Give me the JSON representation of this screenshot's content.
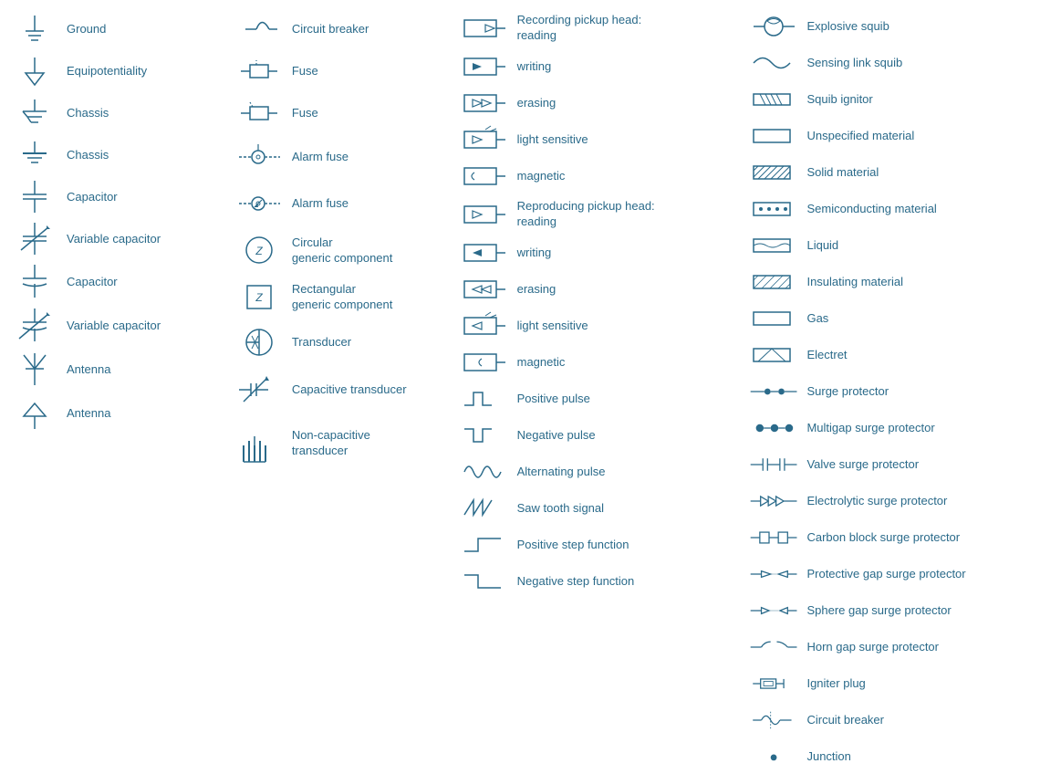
{
  "columns": [
    {
      "id": "col1",
      "items": [
        {
          "id": "ground",
          "label": "Ground"
        },
        {
          "id": "equipotentiality",
          "label": "Equipotentiality"
        },
        {
          "id": "chassis1",
          "label": "Chassis"
        },
        {
          "id": "chassis2",
          "label": "Chassis"
        },
        {
          "id": "capacitor1",
          "label": "Capacitor"
        },
        {
          "id": "variable-capacitor1",
          "label": "Variable capacitor"
        },
        {
          "id": "capacitor2",
          "label": "Capacitor"
        },
        {
          "id": "variable-capacitor2",
          "label": "Variable capacitor"
        },
        {
          "id": "antenna1",
          "label": "Antenna"
        },
        {
          "id": "antenna2",
          "label": "Antenna"
        }
      ]
    },
    {
      "id": "col2",
      "items": [
        {
          "id": "circuit-breaker",
          "label": "Circuit breaker"
        },
        {
          "id": "fuse1",
          "label": "Fuse"
        },
        {
          "id": "fuse2",
          "label": "Fuse"
        },
        {
          "id": "alarm-fuse1",
          "label": "Alarm fuse"
        },
        {
          "id": "alarm-fuse2",
          "label": "Alarm fuse"
        },
        {
          "id": "circular-generic",
          "label": "Circular\ngeneric component"
        },
        {
          "id": "rectangular-generic",
          "label": "Rectangular\ngeneric component"
        },
        {
          "id": "transducer",
          "label": "Transducer"
        },
        {
          "id": "capacitive-transducer",
          "label": "Capacitive transducer"
        },
        {
          "id": "non-capacitive-transducer",
          "label": "Non-capacitive\ntransducer"
        }
      ]
    },
    {
      "id": "col3",
      "items": [
        {
          "id": "rph-reading",
          "label": "Recording pickup head:\nreading"
        },
        {
          "id": "rph-writing",
          "label": "writing"
        },
        {
          "id": "rph-erasing",
          "label": "erasing"
        },
        {
          "id": "rph-light-sensitive",
          "label": "light sensitive"
        },
        {
          "id": "rph-magnetic",
          "label": "magnetic"
        },
        {
          "id": "repr-reading",
          "label": "Reproducing pickup head:\nreading"
        },
        {
          "id": "repr-writing",
          "label": "writing"
        },
        {
          "id": "repr-erasing",
          "label": "erasing"
        },
        {
          "id": "repr-light-sensitive",
          "label": "light sensitive"
        },
        {
          "id": "repr-magnetic",
          "label": "magnetic"
        },
        {
          "id": "positive-pulse",
          "label": "Positive pulse"
        },
        {
          "id": "negative-pulse",
          "label": "Negative pulse"
        },
        {
          "id": "alternating-pulse",
          "label": "Alternating pulse"
        },
        {
          "id": "saw-tooth",
          "label": "Saw tooth signal"
        },
        {
          "id": "positive-step",
          "label": "Positive step function"
        },
        {
          "id": "negative-step",
          "label": "Negative step function"
        }
      ]
    },
    {
      "id": "col4",
      "items": [
        {
          "id": "explosive-squib",
          "label": "Explosive squib"
        },
        {
          "id": "sensing-link-squib",
          "label": "Sensing link squib"
        },
        {
          "id": "squib-ignitor",
          "label": "Squib ignitor"
        },
        {
          "id": "unspecified-material",
          "label": "Unspecified material"
        },
        {
          "id": "solid-material",
          "label": "Solid material"
        },
        {
          "id": "semiconducting-material",
          "label": "Semiconducting material"
        },
        {
          "id": "liquid",
          "label": "Liquid"
        },
        {
          "id": "insulating-material",
          "label": "Insulating material"
        },
        {
          "id": "gas",
          "label": "Gas"
        },
        {
          "id": "electret",
          "label": "Electret"
        },
        {
          "id": "surge-protector",
          "label": "Surge protector"
        },
        {
          "id": "multigap-surge-protector",
          "label": "Multigap surge protector"
        },
        {
          "id": "valve-surge-protector",
          "label": "Valve surge protector"
        },
        {
          "id": "electrolytic-surge-protector",
          "label": "Electrolytic surge protector"
        },
        {
          "id": "carbon-block-surge-protector",
          "label": "Carbon block surge protector"
        },
        {
          "id": "protective-gap-surge-protector",
          "label": "Protective gap surge protector"
        },
        {
          "id": "sphere-gap-surge-protector",
          "label": "Sphere gap surge protector"
        },
        {
          "id": "horn-gap-surge-protector",
          "label": "Horn gap surge protector"
        },
        {
          "id": "igniter-plug",
          "label": "Igniter plug"
        },
        {
          "id": "circuit-breaker2",
          "label": "Circuit breaker"
        },
        {
          "id": "junction",
          "label": "Junction"
        }
      ]
    }
  ]
}
